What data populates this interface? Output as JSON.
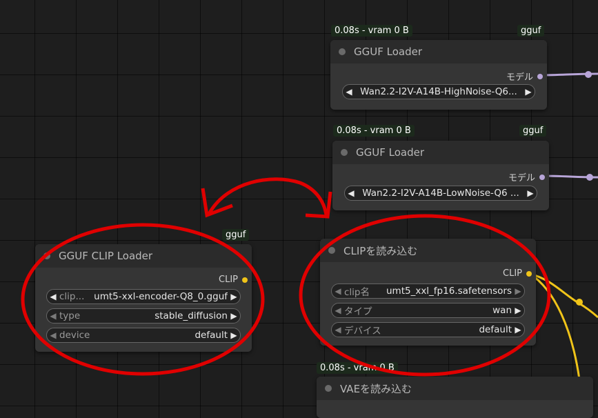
{
  "nodes": {
    "gguf_loader_1": {
      "badge_time": "0.08s - vram 0 B",
      "badge_tag": "gguf",
      "title": "GGUF Loader",
      "output_label": "モデル",
      "widget_value": "Wan2.2-I2V-A14B-HighNoise-Q6..."
    },
    "gguf_loader_2": {
      "badge_time": "0.08s - vram 0 B",
      "badge_tag": "gguf",
      "title": "GGUF Loader",
      "output_label": "モデル",
      "widget_value": "Wan2.2-I2V-A14B-LowNoise-Q6 ..."
    },
    "gguf_clip_loader": {
      "badge_tag": "gguf",
      "title": "GGUF CLIP Loader",
      "output_label": "CLIP",
      "widgets": [
        {
          "label": "clip...",
          "value": "umt5-xxl-encoder-Q8_0.gguf"
        },
        {
          "label": "type",
          "value": "stable_diffusion"
        },
        {
          "label": "device",
          "value": "default"
        }
      ]
    },
    "clip_loader": {
      "title": "CLIPを読み込む",
      "output_label": "CLIP",
      "widgets": [
        {
          "label": "clip名",
          "value": "umt5_xxl_fp16.safetensors"
        },
        {
          "label": "タイプ",
          "value": "wan"
        },
        {
          "label": "デバイス",
          "value": "default"
        }
      ]
    },
    "vae_loader": {
      "badge_time": "0.08s - vram 0 B",
      "title": "VAEを読み込む"
    }
  },
  "colors": {
    "model_wire": "#b8a5d8",
    "clip_wire": "#f0c419",
    "annotation": "#e00000"
  },
  "icons": {
    "left_arrow": "◀",
    "right_arrow": "▶"
  }
}
